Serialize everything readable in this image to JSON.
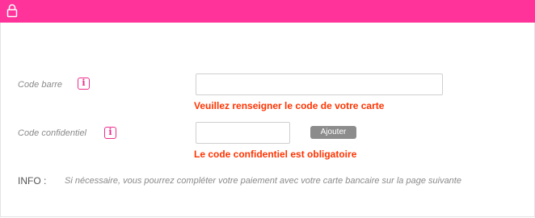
{
  "header": {
    "icon": "lock-icon",
    "color": "#ff3399"
  },
  "form": {
    "barcode": {
      "label": "Code barre",
      "info_icon_text": "i",
      "value": "",
      "error": "Veuillez renseigner le code de votre carte"
    },
    "pin": {
      "label": "Code confidentiel",
      "info_icon_text": "i",
      "value": "",
      "error": "Le code confidentiel est obligatoire"
    },
    "add_button_label": "Ajouter"
  },
  "info": {
    "label": "INFO :",
    "text": "Si nécessaire, vous pourrez compléter votre paiement avec votre carte bancaire sur la page suivante"
  },
  "colors": {
    "accent": "#ee2d8c",
    "error": "#ff3300",
    "button": "#8c8c8c"
  }
}
